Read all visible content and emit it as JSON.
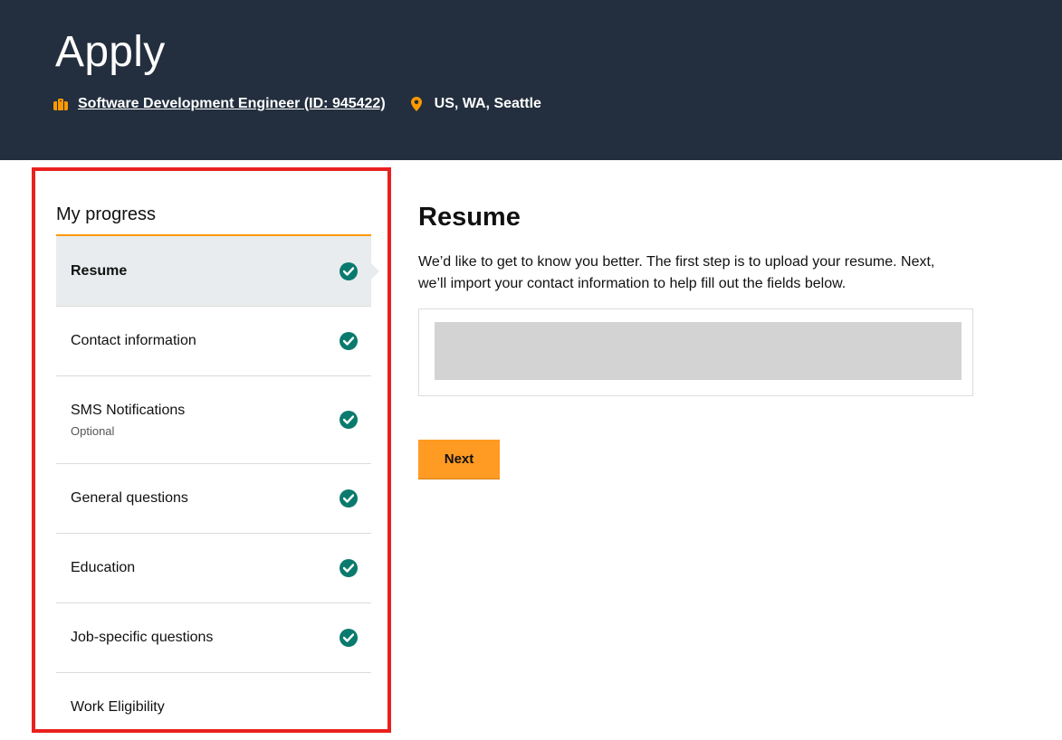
{
  "header": {
    "title": "Apply",
    "job_link": "Software Development Engineer (ID: 945422)",
    "location": "US, WA, Seattle",
    "icons": {
      "job": "briefcase-icon",
      "location": "map-pin-icon"
    },
    "background_color": "#232f3e",
    "accent_color": "#ff9900"
  },
  "sidebar": {
    "title": "My progress",
    "items": [
      {
        "label": "Resume",
        "completed": true,
        "active": true
      },
      {
        "label": "Contact information",
        "completed": true
      },
      {
        "label": "SMS Notifications",
        "sublabel": "Optional",
        "completed": true
      },
      {
        "label": "General questions",
        "completed": true
      },
      {
        "label": "Education",
        "completed": true
      },
      {
        "label": "Job-specific questions",
        "completed": true
      },
      {
        "label": "Work Eligibility",
        "completed": false
      }
    ],
    "check_color": "#0b7a6e",
    "highlight_color": "#e8211e"
  },
  "main": {
    "title": "Resume",
    "description": "We’d like to get to know you better. The first step is to upload your resume. Next, we’ll import your contact information to help fill out the fields below.",
    "next_label": "Next",
    "next_color": "#ff9a22"
  }
}
